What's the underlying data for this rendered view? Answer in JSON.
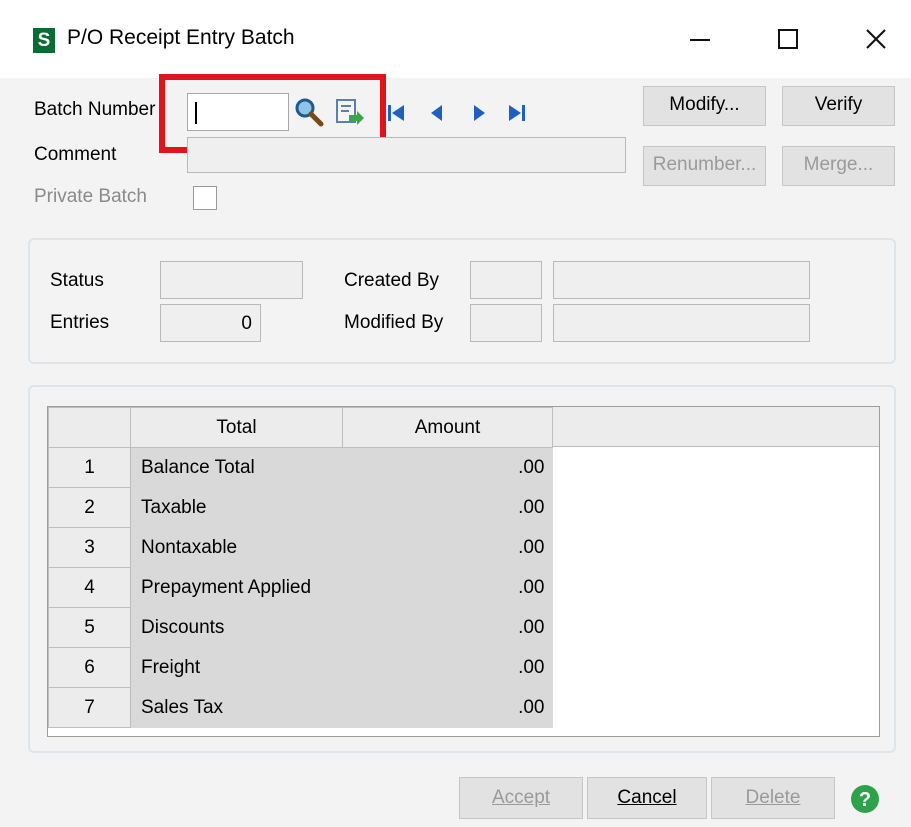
{
  "window": {
    "title": "P/O Receipt Entry Batch",
    "app_icon": "S",
    "app_icon_color": "#0b6b35",
    "controls": [
      "minimize-icon",
      "maximize-icon",
      "close-icon"
    ]
  },
  "batch": {
    "batch_number_label": "Batch Number",
    "batch_number_value": "",
    "comment_label": "Comment",
    "comment_value": "",
    "private_batch_label": "Private Batch",
    "private_batch_checked": false,
    "icons": [
      "lookup-icon",
      "next-batch-icon",
      "first-icon",
      "previous-icon",
      "next-icon",
      "last-icon"
    ]
  },
  "buttons": {
    "modify": "Modify...",
    "verify": "Verify",
    "renumber": "Renumber...",
    "merge": "Merge...",
    "accept": "Accept",
    "cancel": "Cancel",
    "delete": "Delete"
  },
  "info": {
    "status_label": "Status",
    "status_value": "",
    "entries_label": "Entries",
    "entries_value": "0",
    "created_by_label": "Created By",
    "created_by_code": "",
    "created_by_name": "",
    "modified_by_label": "Modified By",
    "modified_by_code": "",
    "modified_by_name": ""
  },
  "totals": {
    "headers": [
      "Total",
      "Amount"
    ],
    "rows": [
      {
        "num": "1",
        "total": "Balance Total",
        "amount": ".00"
      },
      {
        "num": "2",
        "total": "Taxable",
        "amount": ".00"
      },
      {
        "num": "3",
        "total": "Nontaxable",
        "amount": ".00"
      },
      {
        "num": "4",
        "total": "Prepayment Applied",
        "amount": ".00"
      },
      {
        "num": "5",
        "total": "Discounts",
        "amount": ".00"
      },
      {
        "num": "6",
        "total": "Freight",
        "amount": ".00"
      },
      {
        "num": "7",
        "total": "Sales Tax",
        "amount": ".00"
      }
    ]
  },
  "highlight_color": "#e0141d",
  "help_icon": "help-icon"
}
